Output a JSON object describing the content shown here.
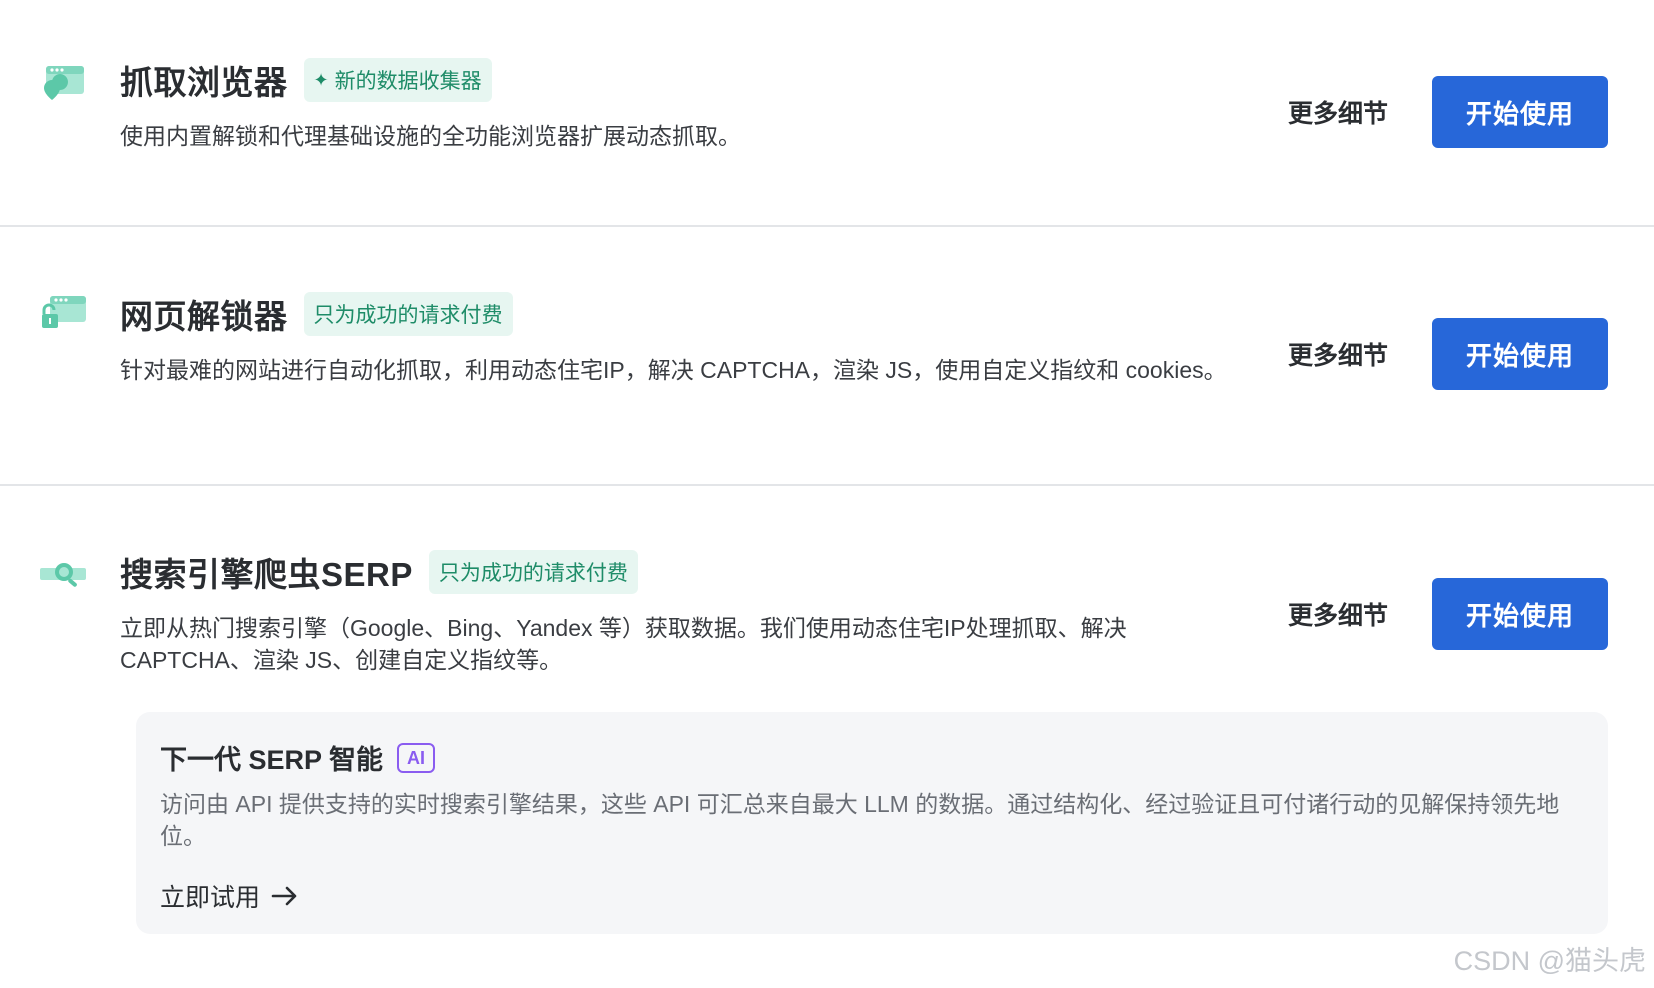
{
  "products": [
    {
      "title": "抓取浏览器",
      "badge": "新的数据收集器",
      "badge_icon": "sparkle-icon",
      "description": "使用内置解锁和代理基础设施的全功能浏览器扩展动态抓取。",
      "details_label": "更多细节",
      "start_label": "开始使用",
      "icon": "browser-pin-icon"
    },
    {
      "title": "网页解锁器",
      "badge": "只为成功的请求付费",
      "description": "针对最难的网站进行自动化抓取，利用动态住宅IP，解决 CAPTCHA，渲染 JS，使用自定义指纹和 cookies。",
      "details_label": "更多细节",
      "start_label": "开始使用",
      "icon": "unlock-browser-icon"
    },
    {
      "title": "搜索引擎爬虫SERP",
      "badge": "只为成功的请求付费",
      "description": "立即从热门搜索引擎（Google、Bing、Yandex 等）获取数据。我们使用动态住宅IP处理抓取、解决 CAPTCHA、渲染 JS、创建自定义指纹等。",
      "details_label": "更多细节",
      "start_label": "开始使用",
      "icon": "search-magnifier-icon"
    }
  ],
  "ai_panel": {
    "title": "下一代 SERP 智能",
    "badge": "AI",
    "description": "访问由 API 提供支持的实时搜索引擎结果，这些 API 可汇总来自最大 LLM 的数据。通过结构化、经过验证且可付诸行动的见解保持领先地位。",
    "cta_label": "立即试用",
    "cta_icon": "arrow-right-icon"
  },
  "watermark": "CSDN @猫头虎",
  "colors": {
    "primary_button": "#2767d9",
    "badge_bg": "#e7f6f1",
    "badge_text": "#1e8c68",
    "icon_accent": "#7fd6bd",
    "ai_badge": "#8a5cf0"
  }
}
